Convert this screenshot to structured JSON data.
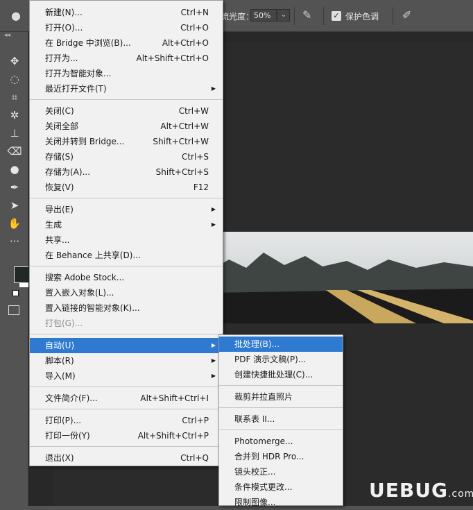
{
  "options_bar": {
    "label": "流光度：",
    "value": "50%",
    "protect_label": "保护色调"
  },
  "file_menu": {
    "groups": [
      [
        {
          "label": "新建(N)...",
          "shortcut": "Ctrl+N"
        },
        {
          "label": "打开(O)...",
          "shortcut": "Ctrl+O"
        },
        {
          "label": "在 Bridge 中浏览(B)...",
          "shortcut": "Alt+Ctrl+O"
        },
        {
          "label": "打开为...",
          "shortcut": "Alt+Shift+Ctrl+O"
        },
        {
          "label": "打开为智能对象...",
          "shortcut": ""
        },
        {
          "label": "最近打开文件(T)",
          "shortcut": ""
        }
      ],
      [
        {
          "label": "关闭(C)",
          "shortcut": "Ctrl+W"
        },
        {
          "label": "关闭全部",
          "shortcut": "Alt+Ctrl+W"
        },
        {
          "label": "关闭并转到 Bridge...",
          "shortcut": "Shift+Ctrl+W"
        },
        {
          "label": "存储(S)",
          "shortcut": "Ctrl+S"
        },
        {
          "label": "存储为(A)...",
          "shortcut": "Shift+Ctrl+S"
        },
        {
          "label": "恢复(V)",
          "shortcut": "F12"
        }
      ],
      [
        {
          "label": "导出(E)",
          "shortcut": ""
        },
        {
          "label": "生成",
          "shortcut": ""
        },
        {
          "label": "共享...",
          "shortcut": ""
        },
        {
          "label": "在 Behance 上共享(D)...",
          "shortcut": ""
        }
      ],
      [
        {
          "label": "搜索 Adobe Stock...",
          "shortcut": ""
        },
        {
          "label": "置入嵌入对象(L)...",
          "shortcut": ""
        },
        {
          "label": "置入链接的智能对象(K)...",
          "shortcut": ""
        },
        {
          "label": "打包(G)...",
          "shortcut": ""
        }
      ],
      [
        {
          "label": "自动(U)",
          "shortcut": ""
        },
        {
          "label": "脚本(R)",
          "shortcut": ""
        },
        {
          "label": "导入(M)",
          "shortcut": ""
        }
      ],
      [
        {
          "label": "文件简介(F)...",
          "shortcut": "Alt+Shift+Ctrl+I"
        }
      ],
      [
        {
          "label": "打印(P)...",
          "shortcut": "Ctrl+P"
        },
        {
          "label": "打印一份(Y)",
          "shortcut": "Alt+Shift+Ctrl+P"
        }
      ],
      [
        {
          "label": "退出(X)",
          "shortcut": "Ctrl+Q"
        }
      ]
    ]
  },
  "auto_submenu": {
    "groups": [
      [
        {
          "label": "批处理(B)..."
        },
        {
          "label": "PDF 演示文稿(P)..."
        },
        {
          "label": "创建快捷批处理(C)..."
        }
      ],
      [
        {
          "label": "裁剪并拉直照片"
        }
      ],
      [
        {
          "label": "联系表 II..."
        }
      ],
      [
        {
          "label": "Photomerge..."
        },
        {
          "label": "合并到 HDR Pro..."
        },
        {
          "label": "镜头校正..."
        },
        {
          "label": "条件模式更改..."
        },
        {
          "label": "限制图像..."
        }
      ]
    ]
  },
  "watermark": {
    "text": "UEBUG",
    "suffix": ".com"
  }
}
